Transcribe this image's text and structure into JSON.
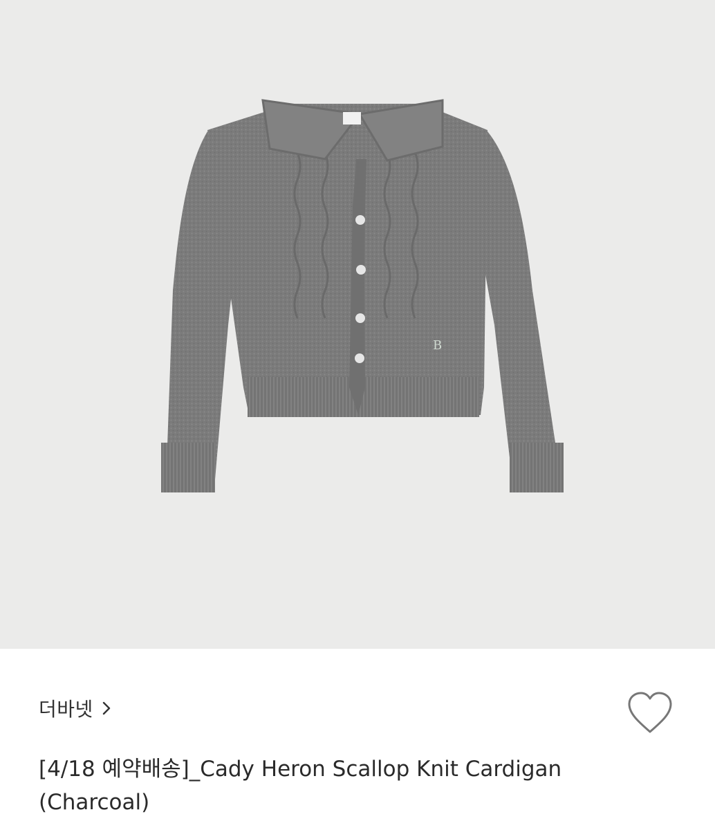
{
  "product": {
    "image_alt": "Gray knit cardigan with scalloped collar",
    "brand": "더바넷",
    "title": "[4/18 예약배송]_Cady Heron Scallop Knit Cardigan (Charcoal)"
  },
  "icons": {
    "brand_chevron": "chevron-right-icon",
    "wishlist": "heart-outline-icon"
  },
  "colors": {
    "image_background": "#ebebea",
    "knit": "#7a7a7a",
    "text": "#2a2a2a",
    "icon_stroke": "#777777"
  }
}
